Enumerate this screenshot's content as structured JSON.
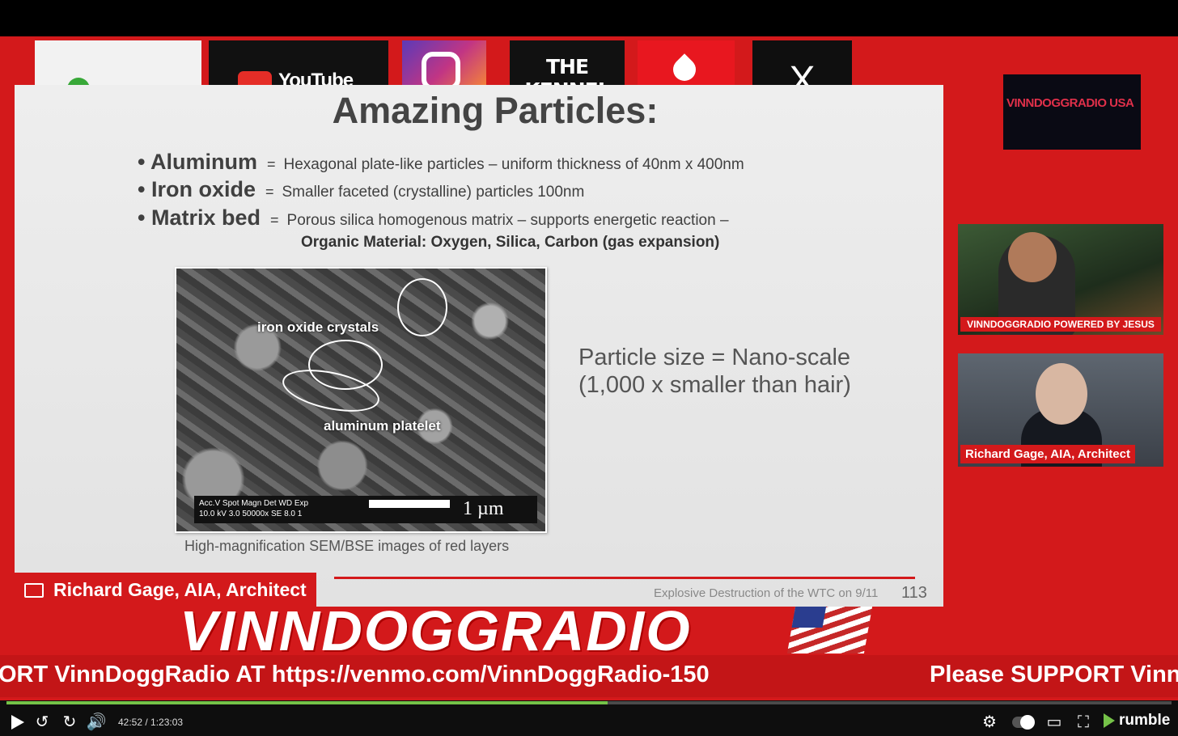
{
  "social_tiles": {
    "youtube_label": "YouTube",
    "kennel_label": "THE KENNEL",
    "x_label": "X"
  },
  "slide": {
    "title": "Amazing Particles:",
    "bullets": [
      {
        "term": "Aluminum",
        "eq": "=",
        "desc": "Hexagonal plate-like particles – uniform thickness of 40nm x 400nm"
      },
      {
        "term": "Iron oxide",
        "eq": "=",
        "desc": "Smaller faceted (crystalline) particles 100nm"
      },
      {
        "term": "Matrix bed",
        "eq": "=",
        "desc": "Porous silica homogenous matrix – supports energetic reaction –"
      }
    ],
    "organic_line": "Organic Material: Oxygen, Silica, Carbon (gas expansion)",
    "sem": {
      "label_iron": "iron oxide crystals",
      "label_al": "aluminum platelet",
      "meta_line1": "Acc.V   Spot Magn   Det   WD   Exp",
      "meta_line2": "10.0 kV 3.0   50000x   SE   8.0   1",
      "scale": "1 µm"
    },
    "caption": "High-magnification SEM/BSE images of red layers",
    "particle_line1": "Particle size = Nano-scale",
    "particle_line2": "(1,000 x smaller than hair)",
    "footer": "Explosive Destruction of the WTC on 9/11",
    "page_number": "113"
  },
  "logo_text": "VINNDOGGRADIO USA",
  "cam1_label": "VINNDOGGRADIO POWERED BY JESUS",
  "cam2_label": "Richard Gage, AIA, Architect",
  "name_plate": "Richard Gage, AIA, Architect",
  "banner": "VINNDOGGRADIO",
  "ticker": {
    "text_a": "ORT VinnDoggRadio AT https://venmo.com/VinnDoggRadio-150",
    "text_b": "Please SUPPORT Vinn"
  },
  "player": {
    "time": "42:52 / 1:23:03",
    "progress": 0.516,
    "brand": "rumble",
    "accent": "#75c248"
  }
}
